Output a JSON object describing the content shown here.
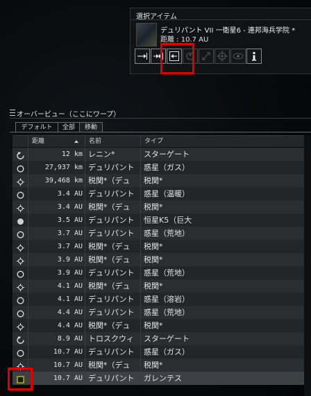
{
  "selected_item": {
    "title": "選択アイテム",
    "name": "デュリパント VII 一衛星6 - 連邦海兵学院 *",
    "distance": "距離 : 10.7 AU",
    "actions": [
      {
        "icon": "approach-icon"
      },
      {
        "icon": "warp-to-icon"
      },
      {
        "icon": "dock-icon"
      },
      {
        "icon": "jump-icon"
      },
      {
        "icon": "orbit-icon"
      },
      {
        "icon": "lock-target-icon"
      },
      {
        "icon": "look-at-icon"
      },
      {
        "icon": "info-icon"
      }
    ]
  },
  "overview": {
    "title": "オーバービュー（ここにワープ）",
    "tabs": [
      {
        "label": "デフォルト",
        "active": false
      },
      {
        "label": "全部",
        "active": false
      },
      {
        "label": "移動",
        "active": true
      }
    ],
    "columns": {
      "distance": "距離",
      "name": "名前",
      "type": "タイプ"
    },
    "rows": [
      {
        "icon": "stargate-icon",
        "distance": "12 km",
        "name": "レニン*",
        "type": "スターゲート"
      },
      {
        "icon": "planet-icon",
        "distance": "27,937 km",
        "name": "デュリパント",
        "type": "惑星（ガス）"
      },
      {
        "icon": "customs-office-icon",
        "distance": "39,468 km",
        "name": "税関*（デュ",
        "type": "税関*"
      },
      {
        "icon": "planet-icon",
        "distance": "3.4 AU",
        "name": "デュリパント",
        "type": "惑星（温暖）"
      },
      {
        "icon": "customs-office-icon",
        "distance": "3.4 AU",
        "name": "税関*（デュ",
        "type": "税関*"
      },
      {
        "icon": "sun-icon",
        "distance": "3.5 AU",
        "name": "デュリパント",
        "type": "恒星K5（巨大"
      },
      {
        "icon": "planet-icon",
        "distance": "3.7 AU",
        "name": "デュリパント",
        "type": "惑星（荒地）"
      },
      {
        "icon": "customs-office-icon",
        "distance": "3.7 AU",
        "name": "税関*（デュ",
        "type": "税関*"
      },
      {
        "icon": "customs-office-icon",
        "distance": "3.9 AU",
        "name": "税関*（デュ",
        "type": "税関*"
      },
      {
        "icon": "planet-icon",
        "distance": "3.9 AU",
        "name": "デュリパント",
        "type": "惑星（荒地）"
      },
      {
        "icon": "customs-office-icon",
        "distance": "4.1 AU",
        "name": "税関*（デュ",
        "type": "税関*"
      },
      {
        "icon": "planet-icon",
        "distance": "4.1 AU",
        "name": "デュリパント",
        "type": "惑星（溶岩）"
      },
      {
        "icon": "planet-icon",
        "distance": "4.4 AU",
        "name": "デュリパント",
        "type": "惑星（荒地）"
      },
      {
        "icon": "customs-office-icon",
        "distance": "4.4 AU",
        "name": "税関*（デュ",
        "type": "税関*"
      },
      {
        "icon": "stargate-icon",
        "distance": "8.9 AU",
        "name": "トロスクウィ",
        "type": "スターゲート"
      },
      {
        "icon": "planet-icon",
        "distance": "10.7 AU",
        "name": "デュリパント",
        "type": "惑星（ガス）"
      },
      {
        "icon": "customs-office-icon",
        "distance": "10.7 AU",
        "name": "税関*（デュ",
        "type": "税関*"
      },
      {
        "icon": "station-icon",
        "distance": "10.7 AU",
        "name": "デュリパント",
        "type": " ガレンテス",
        "selected": true
      }
    ]
  }
}
